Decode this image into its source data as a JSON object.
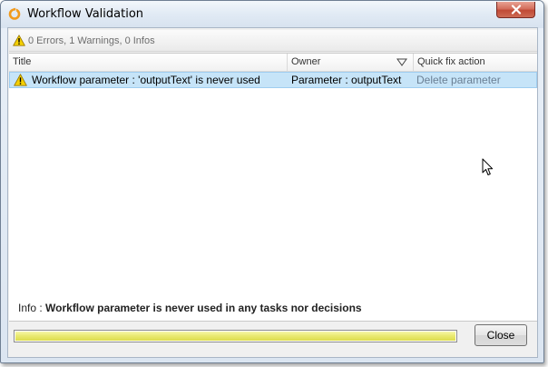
{
  "window": {
    "title": "Workflow Validation",
    "app_icon": "orange-ring-icon",
    "close_icon": "close-icon"
  },
  "summary": {
    "icon": "warning-icon",
    "text": "0 Errors, 1 Warnings, 0 Infos"
  },
  "table": {
    "columns": [
      {
        "label": "Title"
      },
      {
        "label": "Owner",
        "sort_icon": "sort-down-triangle-icon"
      },
      {
        "label": "Quick fix action"
      }
    ],
    "rows": [
      {
        "icon": "warning-icon",
        "title": "Workflow parameter : 'outputText' is never used",
        "owner": "Parameter : outputText",
        "action": "Delete parameter",
        "selected": true
      }
    ]
  },
  "info": {
    "prefix": "Info : ",
    "message": "Workflow parameter is never used in any tasks nor decisions"
  },
  "progress": {
    "fraction": 1.0,
    "color": "#e9e96e"
  },
  "buttons": {
    "close_label": "Close"
  },
  "colors": {
    "selection": "#c6e4f8",
    "action_link": "#6a7f94",
    "close_button_red": "#c04a36",
    "warning_yellow": "#f5d000"
  }
}
